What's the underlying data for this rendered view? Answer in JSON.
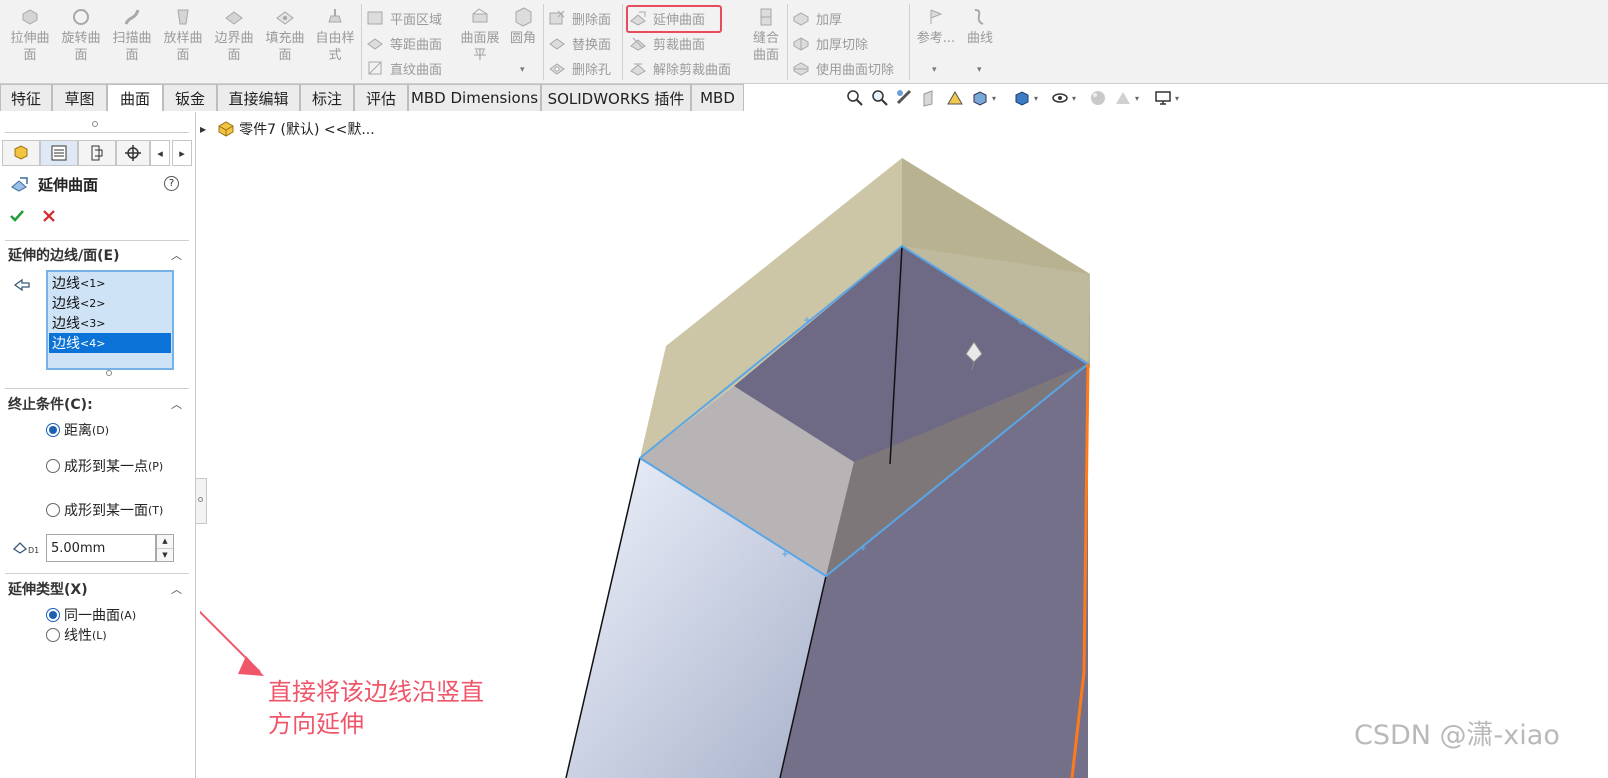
{
  "ribbon": {
    "big_buttons": [
      {
        "id": "extrude-surface",
        "label": "拉伸曲\n面",
        "icon": "extrude-surface-icon"
      },
      {
        "id": "revolve-surface",
        "label": "旋转曲\n面",
        "icon": "revolve-surface-icon"
      },
      {
        "id": "sweep-surface",
        "label": "扫描曲\n面",
        "icon": "sweep-surface-icon"
      },
      {
        "id": "loft-surface",
        "label": "放样曲\n面",
        "icon": "loft-surface-icon"
      },
      {
        "id": "boundary-surface",
        "label": "边界曲\n面",
        "icon": "boundary-surface-icon"
      },
      {
        "id": "fill-surface",
        "label": "填充曲\n面",
        "icon": "fill-surface-icon"
      },
      {
        "id": "freeform",
        "label": "自由样\n式",
        "icon": "freeform-icon"
      }
    ],
    "group1": [
      {
        "id": "planar-surface",
        "label": "平面区域",
        "icon": "planar-surface-icon"
      },
      {
        "id": "offset-surface",
        "label": "等距曲面",
        "icon": "offset-surface-icon"
      },
      {
        "id": "ruled-surface",
        "label": "直纹曲面",
        "icon": "ruled-surface-icon"
      }
    ],
    "flatten_label": "曲面展\n平",
    "fillet_label": "圆角",
    "group2": [
      {
        "id": "delete-face",
        "label": "删除面",
        "icon": "delete-face-icon"
      },
      {
        "id": "replace-face",
        "label": "替换面",
        "icon": "replace-face-icon"
      },
      {
        "id": "delete-hole",
        "label": "删除孔",
        "icon": "delete-hole-icon"
      }
    ],
    "group3": [
      {
        "id": "extend-surface",
        "label": "延伸曲面",
        "icon": "extend-surface-icon"
      },
      {
        "id": "trim-surface",
        "label": "剪裁曲面",
        "icon": "trim-surface-icon"
      },
      {
        "id": "untrim-surface",
        "label": "解除剪裁曲面",
        "icon": "untrim-surface-icon"
      }
    ],
    "knit_label": "缝合\n曲面",
    "group4": [
      {
        "id": "thicken",
        "label": "加厚",
        "icon": "thicken-icon"
      },
      {
        "id": "thicken-cut",
        "label": "加厚切除",
        "icon": "thicken-cut-icon"
      },
      {
        "id": "surface-cut",
        "label": "使用曲面切除",
        "icon": "surface-cut-icon"
      }
    ],
    "reference_label": "参考...",
    "curves_label": "曲线"
  },
  "tabs": [
    "特征",
    "草图",
    "曲面",
    "钣金",
    "直接编辑",
    "标注",
    "评估",
    "MBD Dimensions",
    "SOLIDWORKS 插件",
    "MBD"
  ],
  "active_tab": "曲面",
  "panel": {
    "title": "延伸曲面",
    "help": "?",
    "section_edges": "延伸的边线/面(E)",
    "edges": [
      {
        "label": "边线",
        "sub": "<1>"
      },
      {
        "label": "边线",
        "sub": "<2>"
      },
      {
        "label": "边线",
        "sub": "<3>"
      },
      {
        "label": "边线",
        "sub": "<4>"
      }
    ],
    "section_end": "终止条件(C):",
    "end_options": [
      {
        "label": "距离",
        "key": "(D)",
        "selected": true
      },
      {
        "label": "成形到某一点",
        "key": "(P)",
        "selected": false
      },
      {
        "label": "成形到某一面",
        "key": "(T)",
        "selected": false
      }
    ],
    "distance_value": "5.00mm",
    "distance_icon_label": "D1",
    "section_type": "延伸类型(X)",
    "type_options": [
      {
        "label": "同一曲面",
        "key": "(A)",
        "selected": true
      },
      {
        "label": "线性",
        "key": "(L)",
        "selected": false
      }
    ]
  },
  "tree": {
    "text": "零件7 (默认) <<默..."
  },
  "annotation": [
    "直接将该边线沿竖直",
    "方向延伸"
  ],
  "watermark": "CSDN @潇-xiao",
  "colors": {
    "highlight_red": "#e74c5c",
    "annotation_red": "#f0566a",
    "selection_blue": "#0b73d8",
    "edge_blue": "#5aa6e6",
    "edge_orange": "#ff7a1a",
    "surface_purple": "#757089",
    "surface_tan": "#c8c09c"
  }
}
